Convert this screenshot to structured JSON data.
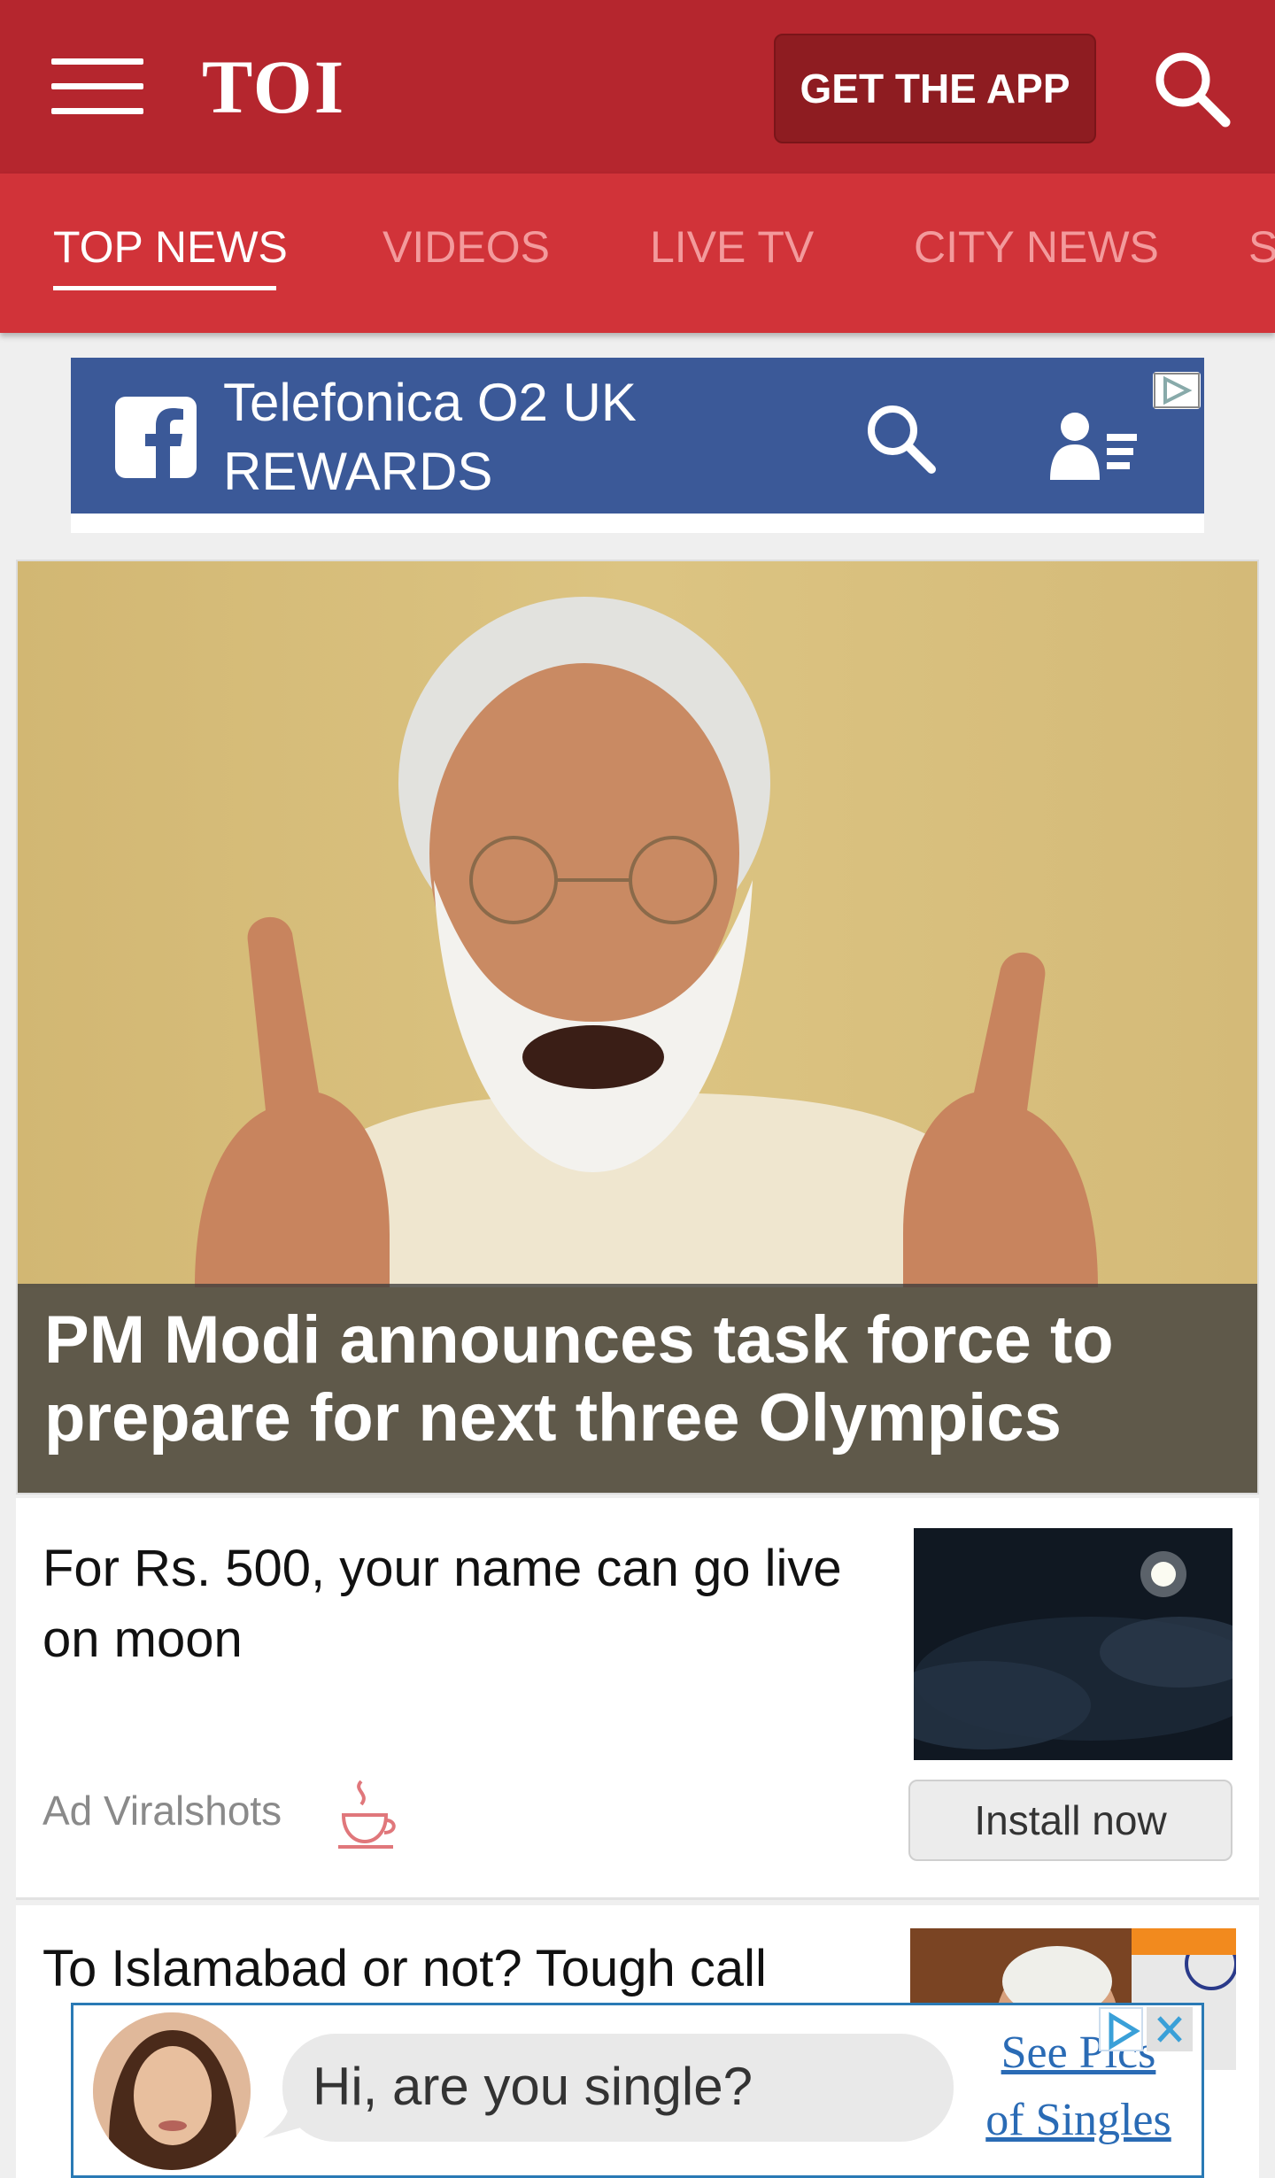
{
  "header": {
    "logo": "TOI",
    "get_app_label": "GET THE APP",
    "brand_color": "#b5262e"
  },
  "tabs": [
    {
      "label": "TOP NEWS",
      "active": true
    },
    {
      "label": "VIDEOS",
      "active": false
    },
    {
      "label": "LIVE TV",
      "active": false
    },
    {
      "label": "CITY NEWS",
      "active": false
    },
    {
      "label": "S",
      "active": false
    }
  ],
  "fb_ad": {
    "title_line1": "Telefonica O2 UK",
    "title_line2": "REWARDS",
    "bar_color": "#3b5998"
  },
  "hero": {
    "headline": "PM Modi announces task force to prepare for next three Olympics"
  },
  "items": [
    {
      "title": "For Rs. 500, your name can go live on moon",
      "ad_label": "Ad Viralshots",
      "cta": "Install now",
      "thumb_icon": "moon-night-image"
    },
    {
      "title": "To Islamabad or not? Tough call",
      "thumb_icon": "modi-photo"
    }
  ],
  "bottom_ad": {
    "bubble_text": "Hi, are you single?",
    "link_line1": "See Pics",
    "link_line2": "of Singles"
  },
  "icons": {
    "menu": "hamburger-menu-icon",
    "search": "search-icon",
    "facebook": "facebook-logo-icon",
    "user_list": "user-list-icon",
    "adchoices": "adchoices-icon",
    "close": "close-icon"
  }
}
